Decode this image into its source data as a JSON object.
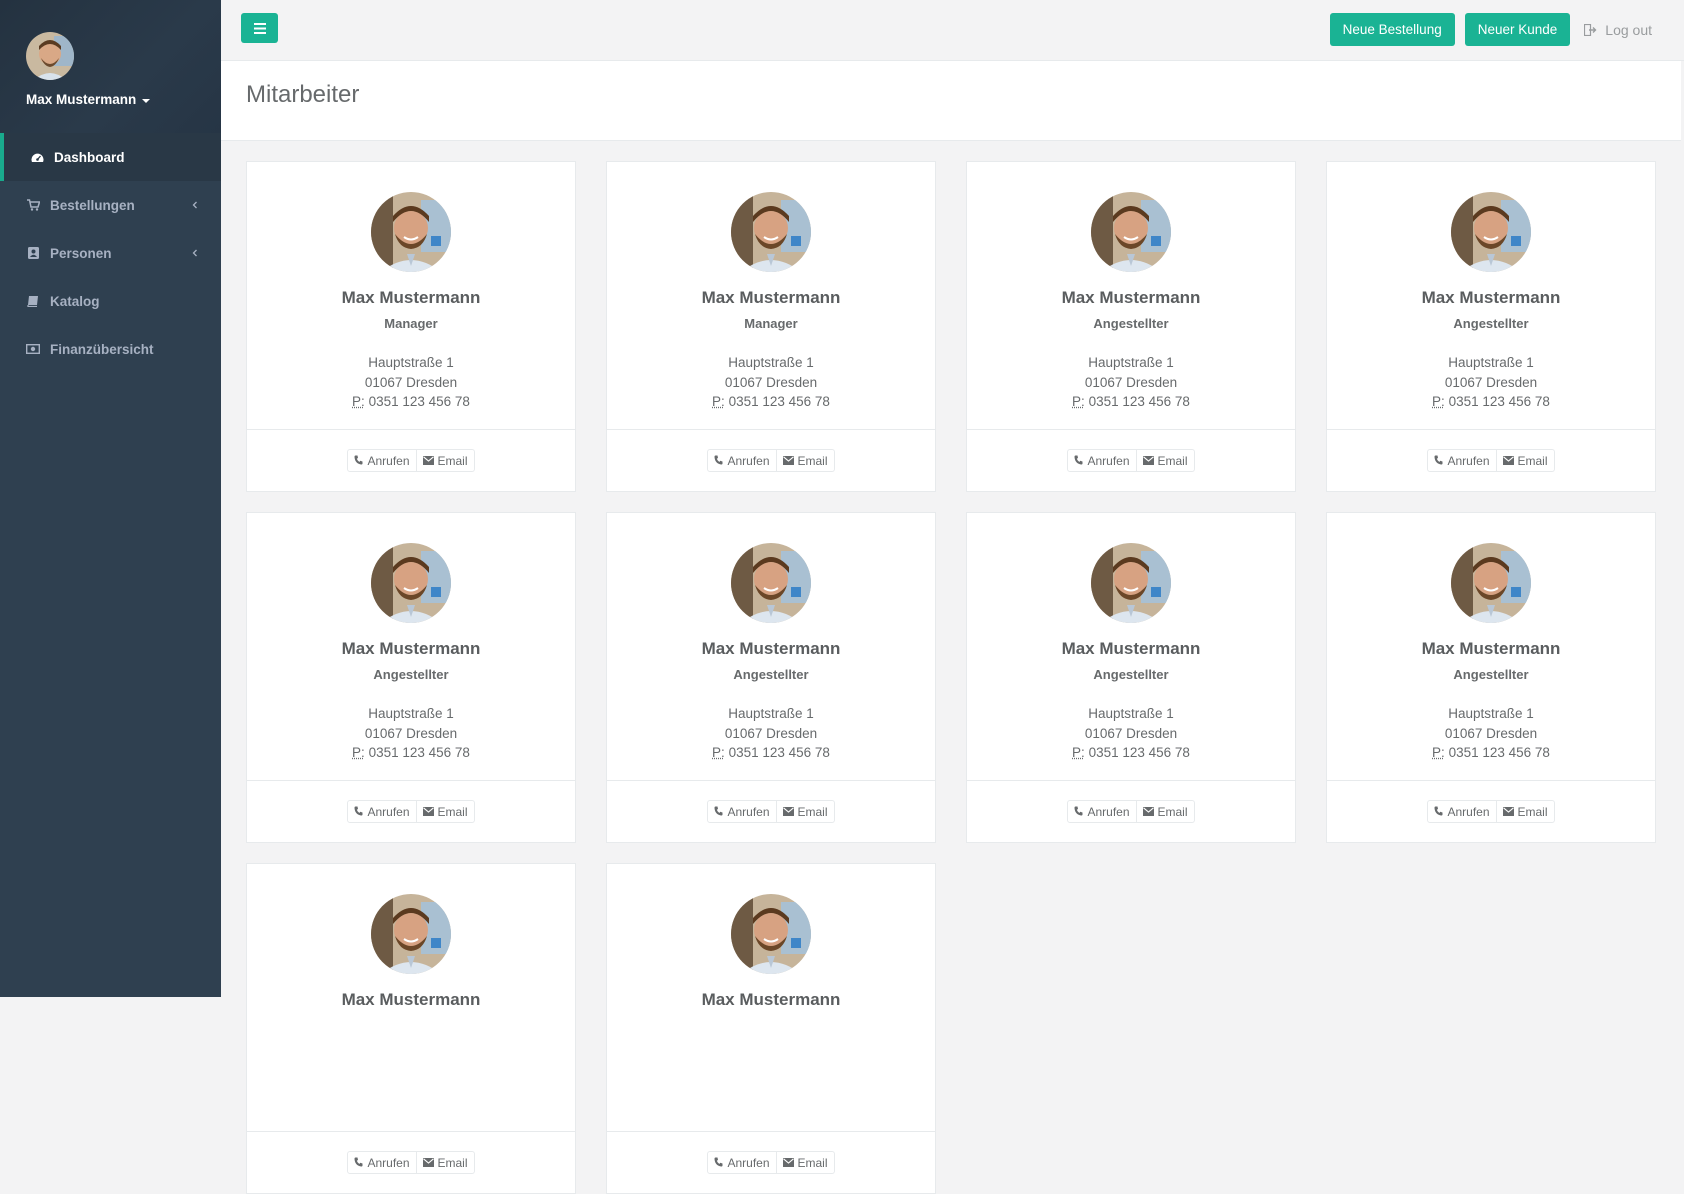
{
  "user": {
    "name": "Max Mustermann"
  },
  "nav": [
    {
      "key": "dashboard",
      "label": "Dashboard",
      "icon": "dashboard-icon",
      "active": true,
      "expandable": false
    },
    {
      "key": "bestellungen",
      "label": "Bestellungen",
      "icon": "cart-icon",
      "active": false,
      "expandable": true
    },
    {
      "key": "personen",
      "label": "Personen",
      "icon": "address-book-icon",
      "active": false,
      "expandable": true
    },
    {
      "key": "katalog",
      "label": "Katalog",
      "icon": "book-icon",
      "active": false,
      "expandable": false
    },
    {
      "key": "finanzen",
      "label": "Finanzübersicht",
      "icon": "money-icon",
      "active": false,
      "expandable": false
    }
  ],
  "topbar": {
    "new_order": "Neue Bestellung",
    "new_customer": "Neuer Kunde",
    "logout": "Log out"
  },
  "page": {
    "title": "Mitarbeiter"
  },
  "cards": [
    {
      "name": "Max Mustermann",
      "role": "Manager",
      "street": "Hauptstraße 1",
      "city": "01067 Dresden",
      "phone_label": "P:",
      "phone": "0351 123 456 78"
    },
    {
      "name": "Max Mustermann",
      "role": "Manager",
      "street": "Hauptstraße 1",
      "city": "01067 Dresden",
      "phone_label": "P:",
      "phone": "0351 123 456 78"
    },
    {
      "name": "Max Mustermann",
      "role": "Angestellter",
      "street": "Hauptstraße 1",
      "city": "01067 Dresden",
      "phone_label": "P:",
      "phone": "0351 123 456 78"
    },
    {
      "name": "Max Mustermann",
      "role": "Angestellter",
      "street": "Hauptstraße 1",
      "city": "01067 Dresden",
      "phone_label": "P:",
      "phone": "0351 123 456 78"
    },
    {
      "name": "Max Mustermann",
      "role": "Angestellter",
      "street": "Hauptstraße 1",
      "city": "01067 Dresden",
      "phone_label": "P:",
      "phone": "0351 123 456 78"
    },
    {
      "name": "Max Mustermann",
      "role": "Angestellter",
      "street": "Hauptstraße 1",
      "city": "01067 Dresden",
      "phone_label": "P:",
      "phone": "0351 123 456 78"
    },
    {
      "name": "Max Mustermann",
      "role": "Angestellter",
      "street": "Hauptstraße 1",
      "city": "01067 Dresden",
      "phone_label": "P:",
      "phone": "0351 123 456 78"
    },
    {
      "name": "Max Mustermann",
      "role": "Angestellter",
      "street": "Hauptstraße 1",
      "city": "01067 Dresden",
      "phone_label": "P:",
      "phone": "0351 123 456 78"
    },
    {
      "name": "Max Mustermann",
      "role": "",
      "street": "",
      "city": "",
      "phone_label": "",
      "phone": ""
    },
    {
      "name": "Max Mustermann",
      "role": "",
      "street": "",
      "city": "",
      "phone_label": "",
      "phone": ""
    }
  ],
  "card_actions": {
    "call": "Anrufen",
    "email": "Email"
  },
  "colors": {
    "sidebar": "#2f4050",
    "accent": "#1ab394",
    "background": "#f3f3f4"
  }
}
